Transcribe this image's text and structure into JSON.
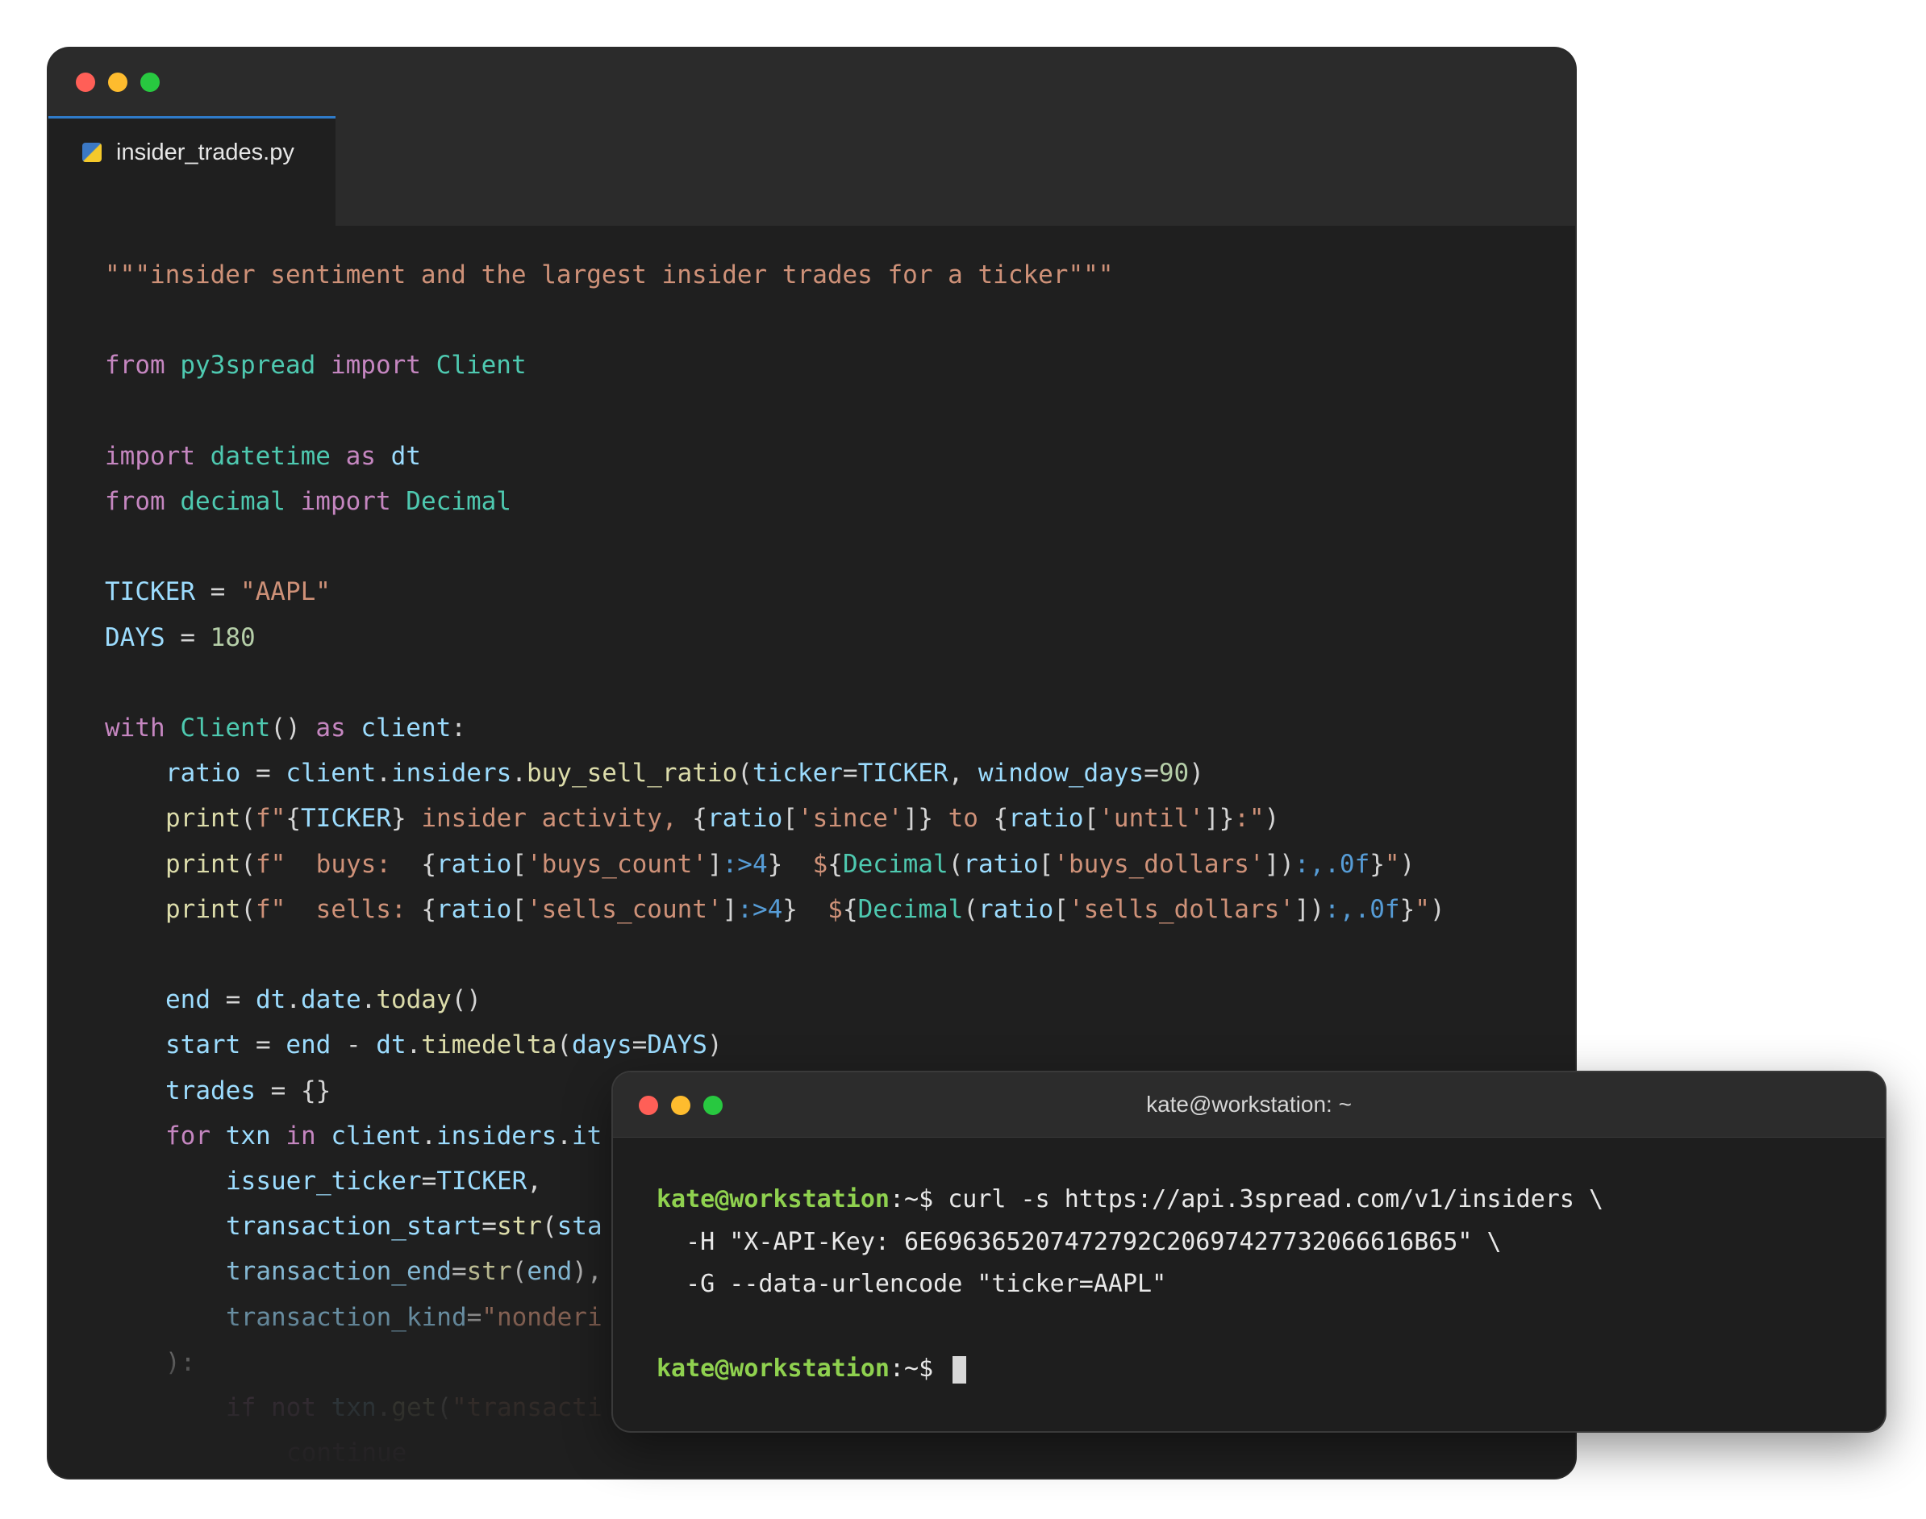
{
  "editor": {
    "tab_label": "insider_trades.py",
    "lines": [
      {
        "indent": 0,
        "tokens": [
          [
            "str",
            "\"\"\"insider sentiment and the largest insider trades for a ticker\"\"\""
          ]
        ]
      },
      {
        "indent": 0,
        "tokens": []
      },
      {
        "indent": 0,
        "tokens": [
          [
            "kw",
            "from "
          ],
          [
            "ty",
            "py3spread "
          ],
          [
            "kw",
            "import "
          ],
          [
            "ty",
            "Client"
          ]
        ]
      },
      {
        "indent": 0,
        "tokens": []
      },
      {
        "indent": 0,
        "tokens": [
          [
            "kw",
            "import "
          ],
          [
            "ty",
            "datetime "
          ],
          [
            "kw",
            "as "
          ],
          [
            "var",
            "dt"
          ]
        ]
      },
      {
        "indent": 0,
        "tokens": [
          [
            "kw",
            "from "
          ],
          [
            "ty",
            "decimal "
          ],
          [
            "kw",
            "import "
          ],
          [
            "ty",
            "Decimal"
          ]
        ]
      },
      {
        "indent": 0,
        "tokens": []
      },
      {
        "indent": 0,
        "tokens": [
          [
            "var",
            "TICKER "
          ],
          [
            "plain",
            "= "
          ],
          [
            "str",
            "\"AAPL\""
          ]
        ]
      },
      {
        "indent": 0,
        "tokens": [
          [
            "var",
            "DAYS "
          ],
          [
            "plain",
            "= "
          ],
          [
            "num",
            "180"
          ]
        ]
      },
      {
        "indent": 0,
        "tokens": []
      },
      {
        "indent": 0,
        "tokens": [
          [
            "kw",
            "with "
          ],
          [
            "ty",
            "Client"
          ],
          [
            "plain",
            "() "
          ],
          [
            "kw",
            "as "
          ],
          [
            "var",
            "client"
          ],
          [
            "plain",
            ":"
          ]
        ]
      },
      {
        "indent": 1,
        "tokens": [
          [
            "var",
            "ratio "
          ],
          [
            "plain",
            "= "
          ],
          [
            "var",
            "client"
          ],
          [
            "plain",
            "."
          ],
          [
            "var",
            "insiders"
          ],
          [
            "plain",
            "."
          ],
          [
            "fn",
            "buy_sell_ratio"
          ],
          [
            "plain",
            "("
          ],
          [
            "var",
            "ticker"
          ],
          [
            "plain",
            "="
          ],
          [
            "var",
            "TICKER"
          ],
          [
            "plain",
            ", "
          ],
          [
            "var",
            "window_days"
          ],
          [
            "plain",
            "="
          ],
          [
            "num",
            "90"
          ],
          [
            "plain",
            ")"
          ]
        ]
      },
      {
        "indent": 1,
        "tokens": [
          [
            "fn",
            "print"
          ],
          [
            "plain",
            "("
          ],
          [
            "str",
            "f\""
          ],
          [
            "plain",
            "{"
          ],
          [
            "var",
            "TICKER"
          ],
          [
            "plain",
            "}"
          ],
          [
            "str",
            " insider activity, "
          ],
          [
            "plain",
            "{"
          ],
          [
            "var",
            "ratio"
          ],
          [
            "plain",
            "["
          ],
          [
            "str",
            "'since'"
          ],
          [
            "plain",
            "]}"
          ],
          [
            "str",
            " to "
          ],
          [
            "plain",
            "{"
          ],
          [
            "var",
            "ratio"
          ],
          [
            "plain",
            "["
          ],
          [
            "str",
            "'until'"
          ],
          [
            "plain",
            "]}"
          ],
          [
            "str",
            ":\""
          ],
          [
            "plain",
            ")"
          ]
        ]
      },
      {
        "indent": 1,
        "tokens": [
          [
            "fn",
            "print"
          ],
          [
            "plain",
            "("
          ],
          [
            "str",
            "f\"  buys:  "
          ],
          [
            "plain",
            "{"
          ],
          [
            "var",
            "ratio"
          ],
          [
            "plain",
            "["
          ],
          [
            "str",
            "'buys_count'"
          ],
          [
            "plain",
            "]"
          ],
          [
            "fmt",
            ":>4"
          ],
          [
            "plain",
            "}"
          ],
          [
            "str",
            "  $"
          ],
          [
            "plain",
            "{"
          ],
          [
            "ty",
            "Decimal"
          ],
          [
            "plain",
            "("
          ],
          [
            "var",
            "ratio"
          ],
          [
            "plain",
            "["
          ],
          [
            "str",
            "'buys_dollars'"
          ],
          [
            "plain",
            "])"
          ],
          [
            "fmt",
            ":,.0f"
          ],
          [
            "plain",
            "}"
          ],
          [
            "str",
            "\""
          ],
          [
            "plain",
            ")"
          ]
        ]
      },
      {
        "indent": 1,
        "tokens": [
          [
            "fn",
            "print"
          ],
          [
            "plain",
            "("
          ],
          [
            "str",
            "f\"  sells: "
          ],
          [
            "plain",
            "{"
          ],
          [
            "var",
            "ratio"
          ],
          [
            "plain",
            "["
          ],
          [
            "str",
            "'sells_count'"
          ],
          [
            "plain",
            "]"
          ],
          [
            "fmt",
            ":>4"
          ],
          [
            "plain",
            "}"
          ],
          [
            "str",
            "  $"
          ],
          [
            "plain",
            "{"
          ],
          [
            "ty",
            "Decimal"
          ],
          [
            "plain",
            "("
          ],
          [
            "var",
            "ratio"
          ],
          [
            "plain",
            "["
          ],
          [
            "str",
            "'sells_dollars'"
          ],
          [
            "plain",
            "])"
          ],
          [
            "fmt",
            ":,.0f"
          ],
          [
            "plain",
            "}"
          ],
          [
            "str",
            "\""
          ],
          [
            "plain",
            ")"
          ]
        ]
      },
      {
        "indent": 0,
        "tokens": []
      },
      {
        "indent": 1,
        "tokens": [
          [
            "var",
            "end "
          ],
          [
            "plain",
            "= "
          ],
          [
            "var",
            "dt"
          ],
          [
            "plain",
            "."
          ],
          [
            "var",
            "date"
          ],
          [
            "plain",
            "."
          ],
          [
            "fn",
            "today"
          ],
          [
            "plain",
            "()"
          ]
        ]
      },
      {
        "indent": 1,
        "tokens": [
          [
            "var",
            "start "
          ],
          [
            "plain",
            "= "
          ],
          [
            "var",
            "end "
          ],
          [
            "plain",
            "- "
          ],
          [
            "var",
            "dt"
          ],
          [
            "plain",
            "."
          ],
          [
            "fn",
            "timedelta"
          ],
          [
            "plain",
            "("
          ],
          [
            "var",
            "days"
          ],
          [
            "plain",
            "="
          ],
          [
            "var",
            "DAYS"
          ],
          [
            "plain",
            ")"
          ]
        ]
      },
      {
        "indent": 1,
        "tokens": [
          [
            "var",
            "trades "
          ],
          [
            "plain",
            "= {}"
          ]
        ]
      },
      {
        "indent": 1,
        "tokens": [
          [
            "kw",
            "for "
          ],
          [
            "var",
            "txn "
          ],
          [
            "kw",
            "in "
          ],
          [
            "var",
            "client"
          ],
          [
            "plain",
            "."
          ],
          [
            "var",
            "insiders"
          ],
          [
            "plain",
            "."
          ],
          [
            "var",
            "it"
          ]
        ]
      },
      {
        "indent": 2,
        "tokens": [
          [
            "var",
            "issuer_ticker"
          ],
          [
            "plain",
            "="
          ],
          [
            "var",
            "TICKER"
          ],
          [
            "plain",
            ","
          ]
        ]
      },
      {
        "indent": 2,
        "tokens": [
          [
            "var",
            "transaction_start"
          ],
          [
            "plain",
            "="
          ],
          [
            "fn",
            "str"
          ],
          [
            "plain",
            "("
          ],
          [
            "var",
            "sta"
          ]
        ]
      },
      {
        "indent": 2,
        "tokens": [
          [
            "var",
            "transaction_end"
          ],
          [
            "plain",
            "="
          ],
          [
            "fn",
            "str"
          ],
          [
            "plain",
            "("
          ],
          [
            "var",
            "end"
          ],
          [
            "plain",
            "),"
          ]
        ]
      },
      {
        "indent": 2,
        "tokens": [
          [
            "var",
            "transaction_kind"
          ],
          [
            "plain",
            "="
          ],
          [
            "str",
            "\"nonderi"
          ]
        ]
      },
      {
        "indent": 1,
        "tokens": [
          [
            "plain",
            "):"
          ]
        ]
      },
      {
        "indent": 2,
        "tokens": [
          [
            "kw",
            "if "
          ],
          [
            "kw",
            "not "
          ],
          [
            "var",
            "txn"
          ],
          [
            "plain",
            "."
          ],
          [
            "fn",
            "get"
          ],
          [
            "plain",
            "("
          ],
          [
            "str",
            "\"transacti"
          ]
        ]
      },
      {
        "indent": 3,
        "tokens": [
          [
            "kw",
            "continue"
          ]
        ]
      }
    ]
  },
  "terminal": {
    "title": "kate@workstation: ~",
    "lines": [
      {
        "user": "kate@workstation",
        "path": ":~$ ",
        "text": "curl -s https://api.3spread.com/v1/insiders \\"
      },
      {
        "user": "",
        "path": "",
        "text": "  -H \"X-API-Key: 6E696365207472792C20697427732066616B65\" \\"
      },
      {
        "user": "",
        "path": "",
        "text": "  -G --data-urlencode \"ticker=AAPL\""
      },
      {
        "user": "",
        "path": "",
        "text": ""
      },
      {
        "user": "kate@workstation",
        "path": ":~$ ",
        "text": "",
        "cursor": true
      }
    ]
  }
}
